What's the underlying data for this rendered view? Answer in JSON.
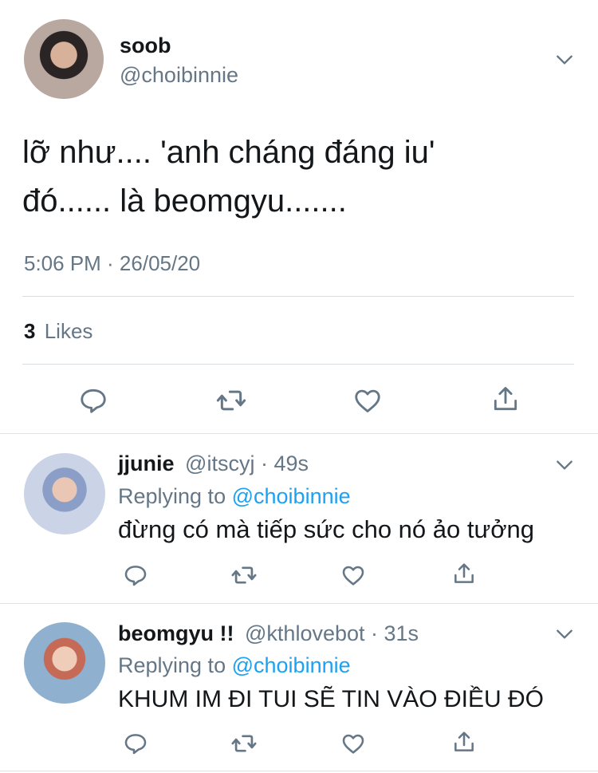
{
  "main_tweet": {
    "display_name": "soob",
    "handle": "@choibinnie",
    "text_line1": "lỡ như.... 'anh cháng đáng iu'",
    "text_line2": "đó...... là beomgyu.......",
    "timestamp": "5:06 PM · 26/05/20",
    "likes_count": "3",
    "likes_label": "Likes"
  },
  "replies": [
    {
      "display_name": "jjunie",
      "handle": "@itscyj",
      "time": "49s",
      "replying_to_label": "Replying to",
      "replying_to_handle": "@choibinnie",
      "text": "đừng có mà tiếp sức cho nó ảo tưởng"
    },
    {
      "display_name": "beomgyu !!",
      "handle": "@kthlovebot",
      "time": "31s",
      "replying_to_label": "Replying to",
      "replying_to_handle": "@choibinnie",
      "text": "KHUM IM ĐI TUI SẼ TIN VÀO ĐIỀU ĐÓ"
    }
  ],
  "icons": [
    "reply-icon",
    "retweet-icon",
    "like-icon",
    "share-icon",
    "chevron-down-icon"
  ],
  "colors": {
    "link": "#1da1f2",
    "muted": "#657786",
    "text": "#14171a",
    "icon": "#657786"
  }
}
